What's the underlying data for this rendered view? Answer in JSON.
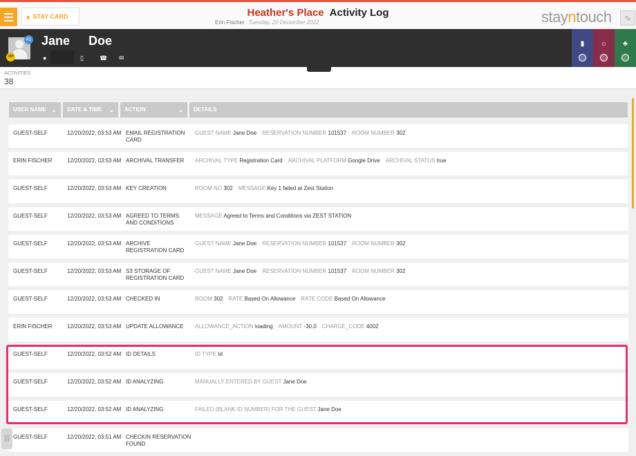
{
  "header": {
    "menu_icon": "hamburger-icon",
    "back_label": "STAY CARD",
    "hotel_name": "Heather's Place",
    "page_title": "Activity Log",
    "user_name": "Erin Fischer",
    "date": "Tuesday, 20 December 2022",
    "logo": {
      "part1": "stay",
      "part2": "n",
      "part3": "touch"
    },
    "accent_color": "#f6a623"
  },
  "guest": {
    "first_name": "Jane",
    "last_name": "Doe",
    "badge_count": "41",
    "vip_label": "VIP",
    "tiles": [
      {
        "icon": "key-card-icon",
        "color": "#3f4a84"
      },
      {
        "icon": "globe-icon",
        "color": "#8a2d4a"
      },
      {
        "icon": "rewards-icon",
        "color": "#2f7a4a"
      }
    ]
  },
  "stats": {
    "label": "ACTIVITIES",
    "count": "38"
  },
  "table": {
    "columns": [
      "USER NAME",
      "DATE & TIME",
      "ACTION",
      "DETAILS"
    ],
    "rows": [
      {
        "user": "GUEST-SELF",
        "datetime": "12/20/2022, 03:53 AM",
        "action": "EMAIL REGISTRATION CARD",
        "details": [
          {
            "k": "GUEST NAME",
            "v": "Jane Doe"
          },
          {
            "k": "RESERVATION NUMBER",
            "v": "101537"
          },
          {
            "k": "ROOM NUMBER",
            "v": "302"
          }
        ]
      },
      {
        "user": "ERIN FISCHER",
        "datetime": "12/20/2022, 03:53 AM",
        "action": "ARCHIVAL TRANSFER",
        "details": [
          {
            "k": "ARCHIVAL TYPE",
            "v": "Registration Card"
          },
          {
            "k": "ARCHIVAL PLATFORM",
            "v": "Google Drive"
          },
          {
            "k": "ARCHIVAL STATUS",
            "v": "true"
          }
        ]
      },
      {
        "user": "GUEST-SELF",
        "datetime": "12/20/2022, 03:53 AM",
        "action": "KEY CREATION",
        "details": [
          {
            "k": "ROOM NO",
            "v": "302"
          },
          {
            "k": "MESSAGE",
            "v": "Key 1 failed at Zest Station"
          }
        ]
      },
      {
        "user": "GUEST-SELF",
        "datetime": "12/20/2022, 03:53 AM",
        "action": "AGREED TO TERMS AND CONDITIONS",
        "details": [
          {
            "k": "MESSAGE",
            "v": "Agreed to Terms and Conditions via ZEST STATION"
          }
        ]
      },
      {
        "user": "GUEST-SELF",
        "datetime": "12/20/2022, 03:53 AM",
        "action": "ARCHIVE REGISTRATION CARD",
        "details": [
          {
            "k": "GUEST NAME",
            "v": "Jane Doe"
          },
          {
            "k": "RESERVATION NUMBER",
            "v": "101537"
          },
          {
            "k": "ROOM NUMBER",
            "v": "302"
          }
        ]
      },
      {
        "user": "GUEST-SELF",
        "datetime": "12/20/2022, 03:53 AM",
        "action": "S3 STORAGE OF REGISTRATION CARD",
        "details": [
          {
            "k": "GUEST NAME",
            "v": "Jane Doe"
          },
          {
            "k": "RESERVATION NUMBER",
            "v": "101537"
          },
          {
            "k": "ROOM NUMBER",
            "v": "302"
          }
        ]
      },
      {
        "user": "GUEST-SELF",
        "datetime": "12/20/2022, 03:53 AM",
        "action": "CHECKED IN",
        "details": [
          {
            "k": "ROOM",
            "v": "302"
          },
          {
            "k": "RATE",
            "v": "Based On Allowance"
          },
          {
            "k": "RATE CODE",
            "v": "Based On Allowance"
          }
        ]
      },
      {
        "user": "ERIN FISCHER",
        "datetime": "12/20/2022, 03:53 AM",
        "action": "UPDATE ALLOWANCE",
        "details": [
          {
            "k": "ALLOWANCE_ACTION",
            "v": "loading"
          },
          {
            "k": "AMOUNT",
            "v": "-30.0"
          },
          {
            "k": "CHARGE_CODE",
            "v": "4002"
          }
        ]
      },
      {
        "user": "GUEST-SELF",
        "datetime": "12/20/2022, 03:52 AM",
        "action": "ID DETAILS",
        "details": [
          {
            "k": "ID TYPE",
            "v": "Id"
          }
        ]
      },
      {
        "user": "GUEST-SELF",
        "datetime": "12/20/2022, 03:52 AM",
        "action": "ID ANALYZING",
        "details": [
          {
            "k": "MANUALLY ENTERED BY GUEST",
            "v": "Jane Doe"
          }
        ]
      },
      {
        "user": "GUEST-SELF",
        "datetime": "12/20/2022, 03:52 AM",
        "action": "ID ANALYZING",
        "details": [
          {
            "k": "FAILED (BLANK ID NUMBER) FOR THE GUEST",
            "v": "Jane Doe"
          }
        ]
      },
      {
        "user": "GUEST-SELF",
        "datetime": "12/20/2022, 03:51 AM",
        "action": "CHECKIN RESERVATION FOUND",
        "details": []
      }
    ]
  }
}
